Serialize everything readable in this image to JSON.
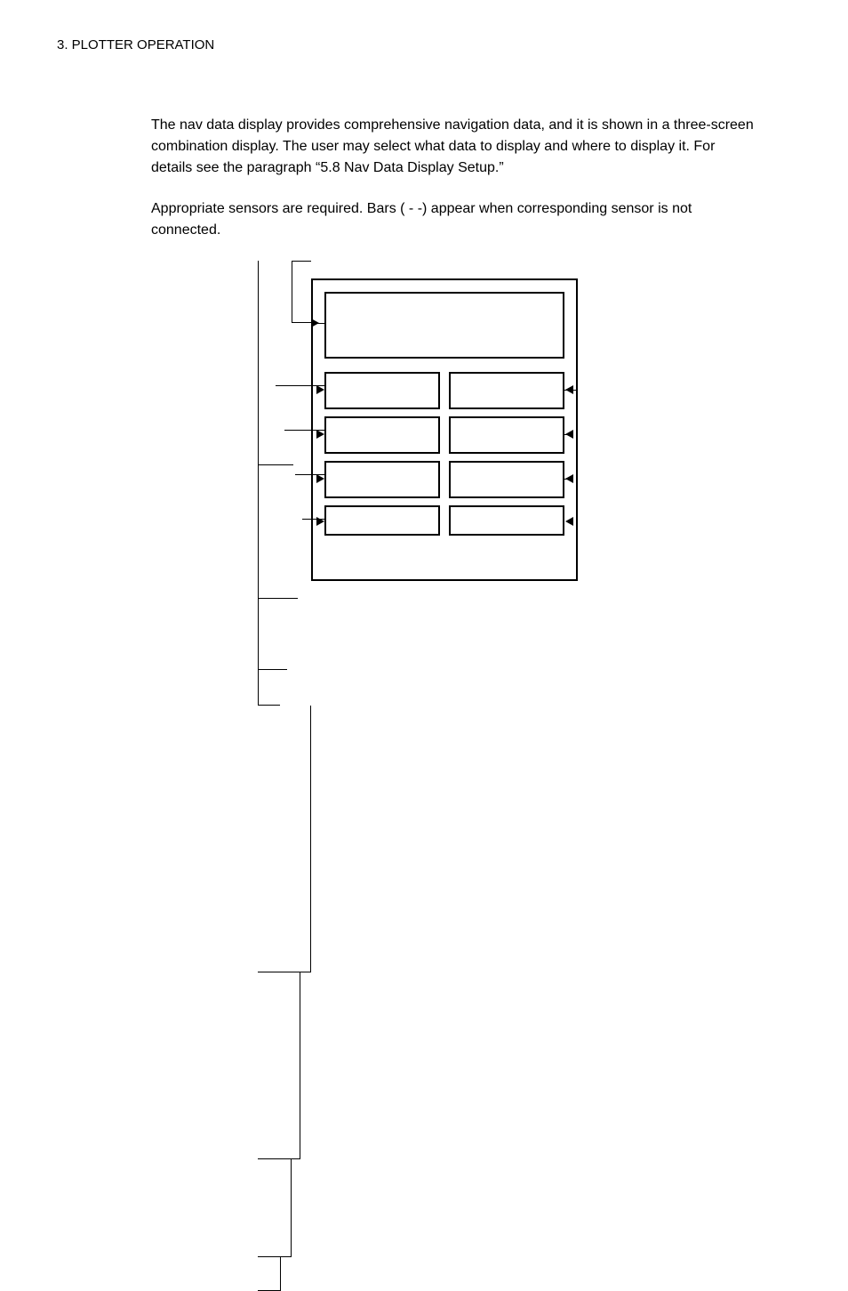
{
  "header": "3. PLOTTER OPERATION",
  "para1": "The nav data display provides comprehensive navigation data, and it is shown in a three-screen combination display. The user may select what data to display and where to display it. For details see the paragraph “5.8 Nav Data Display Setup.”",
  "para2": "Appropriate sensors are required. Bars ( - -) appear when corresponding sensor is not connected."
}
